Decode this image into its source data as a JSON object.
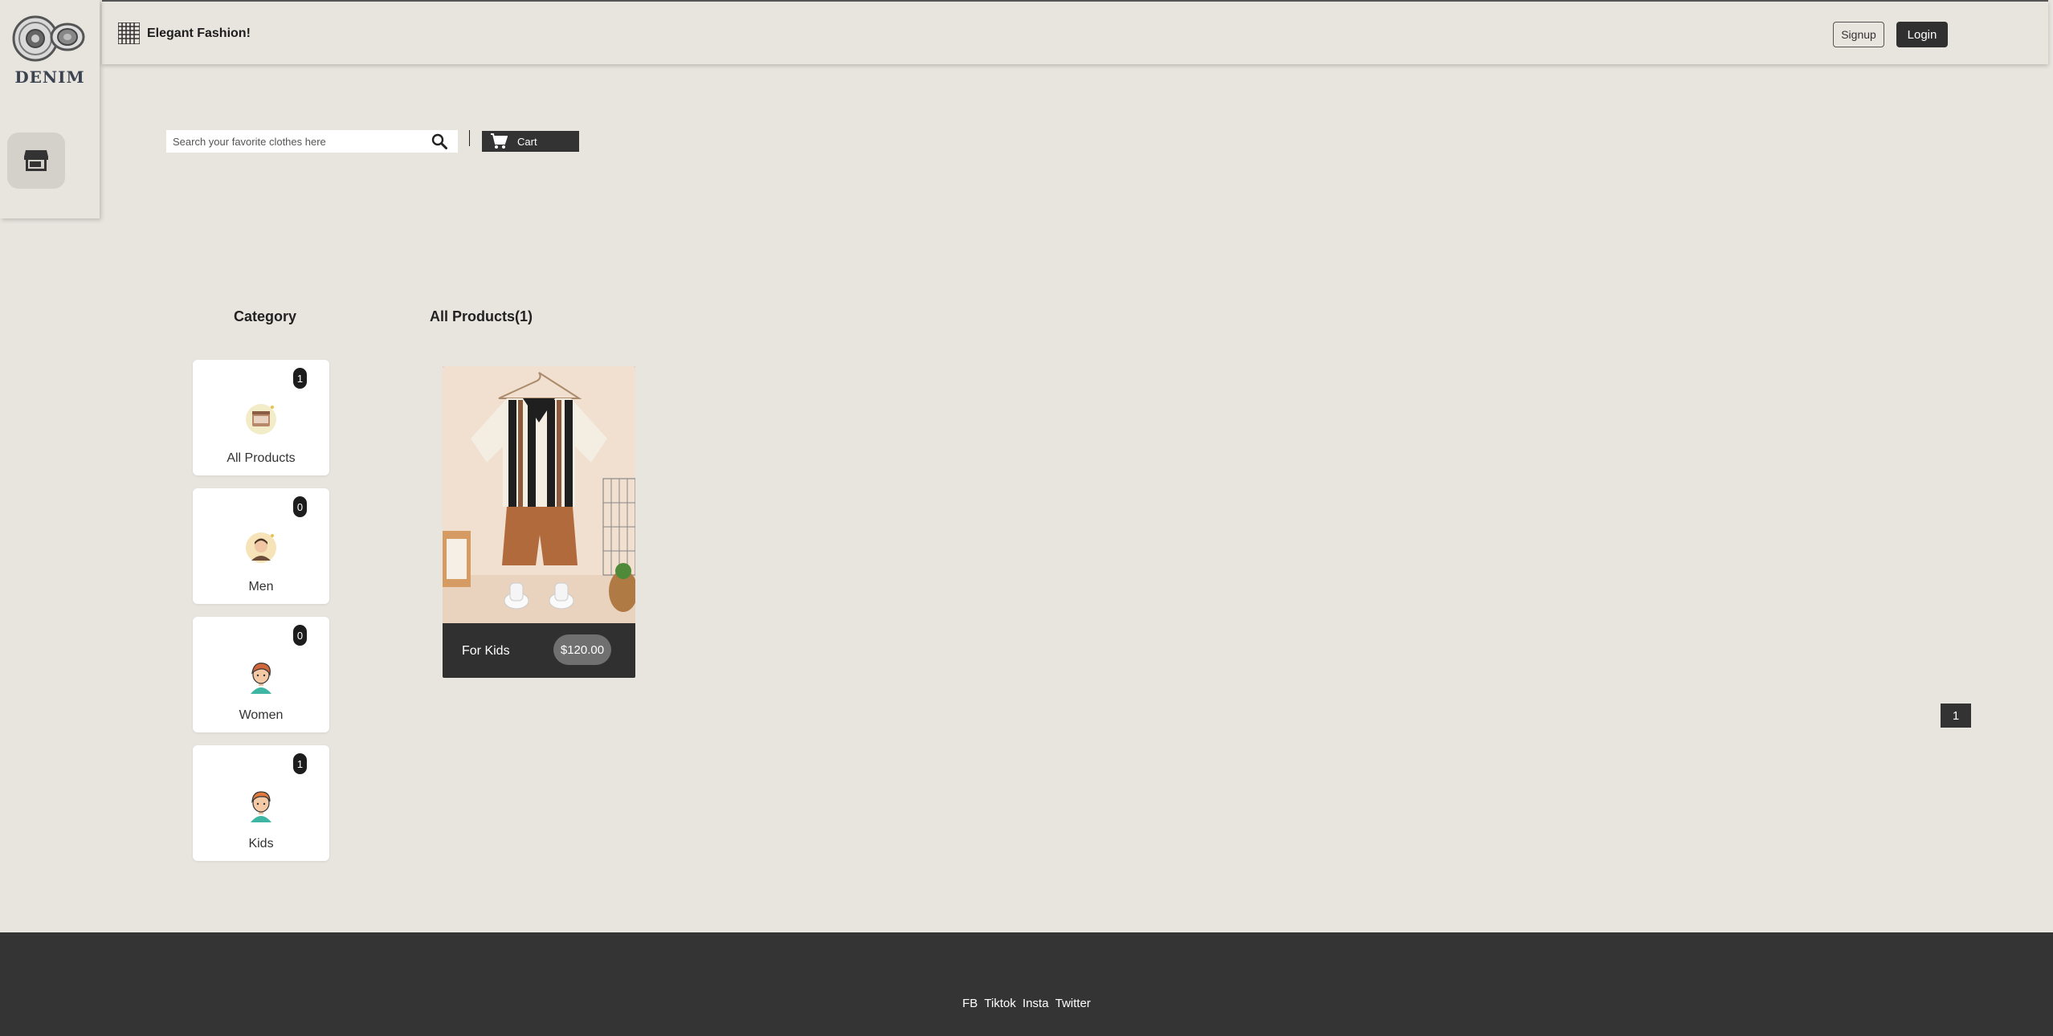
{
  "sidebar": {
    "logo_text": "DENIM",
    "store_icon": "store-icon"
  },
  "header": {
    "title": "Elegant Fashion!",
    "menu_icon": "grid-menu-icon",
    "signup_label": "Signup",
    "login_label": "Login"
  },
  "search": {
    "placeholder": "Search your favorite clothes here",
    "value": "",
    "icon": "search-icon"
  },
  "cart": {
    "label": "Cart",
    "icon": "cart-icon"
  },
  "categories": {
    "title": "Category",
    "items": [
      {
        "label": "All Products",
        "count": "1",
        "icon": "shopping-basket-icon"
      },
      {
        "label": "Men",
        "count": "0",
        "icon": "man-avatar-icon"
      },
      {
        "label": "Women",
        "count": "0",
        "icon": "woman-avatar-icon"
      },
      {
        "label": "Kids",
        "count": "1",
        "icon": "kid-avatar-icon"
      }
    ]
  },
  "products": {
    "title": "All Products(1)",
    "items": [
      {
        "name": "For Kids",
        "price": "$120.00",
        "image": "kids-striped-shirt-outfit-photo"
      }
    ]
  },
  "pagination": {
    "current": "1"
  },
  "footer": {
    "links": [
      "FB",
      "Tiktok",
      "Insta",
      "Twitter"
    ]
  },
  "colors": {
    "background": "#e8e5df",
    "dark": "#303030",
    "footer": "#343434",
    "card": "#ffffff",
    "price_pill": "#707070"
  }
}
